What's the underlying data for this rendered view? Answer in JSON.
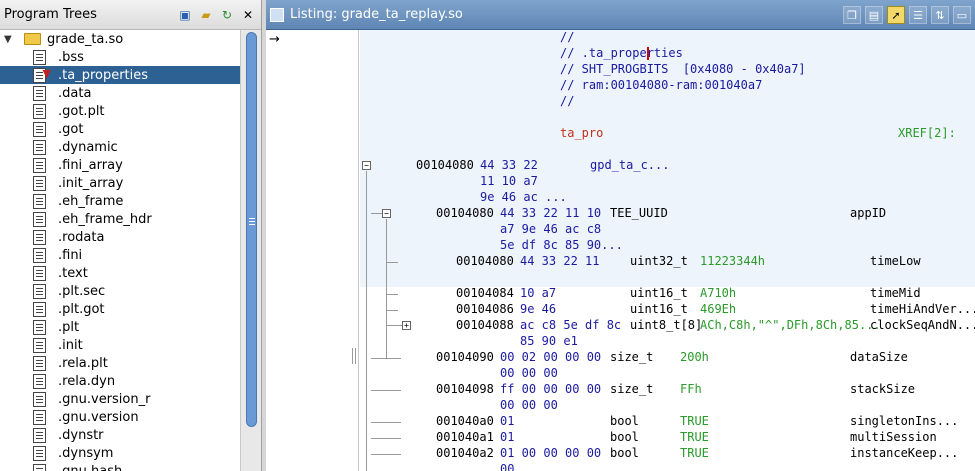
{
  "tree": {
    "title": "Program Trees",
    "root": "grade_ta.so",
    "items": [
      {
        "label": ".bss",
        "selected": false
      },
      {
        "label": ".ta_properties",
        "selected": true
      },
      {
        "label": ".data",
        "selected": false
      },
      {
        "label": ".got.plt",
        "selected": false
      },
      {
        "label": ".got",
        "selected": false
      },
      {
        "label": ".dynamic",
        "selected": false
      },
      {
        "label": ".fini_array",
        "selected": false
      },
      {
        "label": ".init_array",
        "selected": false
      },
      {
        "label": ".eh_frame",
        "selected": false
      },
      {
        "label": ".eh_frame_hdr",
        "selected": false
      },
      {
        "label": ".rodata",
        "selected": false
      },
      {
        "label": ".fini",
        "selected": false
      },
      {
        "label": ".text",
        "selected": false
      },
      {
        "label": ".plt.sec",
        "selected": false
      },
      {
        "label": ".plt.got",
        "selected": false
      },
      {
        "label": ".plt",
        "selected": false
      },
      {
        "label": ".init",
        "selected": false
      },
      {
        "label": ".rela.plt",
        "selected": false
      },
      {
        "label": ".rela.dyn",
        "selected": false
      },
      {
        "label": ".gnu.version_r",
        "selected": false
      },
      {
        "label": ".gnu.version",
        "selected": false
      },
      {
        "label": ".dynstr",
        "selected": false
      },
      {
        "label": ".dynsym",
        "selected": false
      },
      {
        "label": ".gnu.hash",
        "selected": false
      }
    ]
  },
  "listing": {
    "title": "Listing:  grade_ta_replay.so",
    "comments": [
      "//",
      "// .ta_properties",
      "// SHT_PROGBITS  [0x4080 - 0x40a7]",
      "// ram:00104080-ram:001040a7",
      "//"
    ],
    "label": "ta_pro",
    "xref": "XREF[2]:",
    "rows": [
      {
        "addr": "00104080",
        "bytes": "44 33 22",
        "mnem": "gpd_ta_c...",
        "type": "",
        "val": "",
        "name": ""
      },
      {
        "addr": "",
        "bytes": "11 10 a7",
        "mnem": "",
        "type": "",
        "val": "",
        "name": ""
      },
      {
        "addr": "",
        "bytes": "9e 46 ac ...",
        "mnem": "",
        "type": "",
        "val": "",
        "name": ""
      },
      {
        "addr": "00104080",
        "bytes": "44 33 22 11 10",
        "mnem": "",
        "type": "TEE_UUID",
        "val": "",
        "name": "appID"
      },
      {
        "addr": "",
        "bytes": "a7 9e 46 ac c8",
        "mnem": "",
        "type": "",
        "val": "",
        "name": ""
      },
      {
        "addr": "",
        "bytes": "5e df 8c 85 90...",
        "mnem": "",
        "type": "",
        "val": "",
        "name": ""
      },
      {
        "addr": "00104080",
        "bytes": "44 33 22 11",
        "mnem": "",
        "type": "uint32_t",
        "val": "11223344h",
        "name": "timeLow"
      },
      {
        "addr": "00104084",
        "bytes": "10 a7",
        "mnem": "",
        "type": "uint16_t",
        "val": "A710h",
        "name": "timeMid"
      },
      {
        "addr": "00104086",
        "bytes": "9e 46",
        "mnem": "",
        "type": "uint16_t",
        "val": "469Eh",
        "name": "timeHiAndVer..."
      },
      {
        "addr": "00104088",
        "bytes": "ac c8 5e df 8c",
        "mnem": "",
        "type": "uint8_t[8]",
        "val": "ACh,C8h,\"^\",DFh,8Ch,85...",
        "name": "clockSeqAndN..."
      },
      {
        "addr": "",
        "bytes": "85 90 e1",
        "mnem": "",
        "type": "",
        "val": "",
        "name": ""
      },
      {
        "addr": "00104090",
        "bytes": "00 02 00 00 00",
        "mnem": "",
        "type": "size_t",
        "val": "200h",
        "name": "dataSize"
      },
      {
        "addr": "",
        "bytes": "00 00 00",
        "mnem": "",
        "type": "",
        "val": "",
        "name": ""
      },
      {
        "addr": "00104098",
        "bytes": "ff 00 00 00 00",
        "mnem": "",
        "type": "size_t",
        "val": "FFh",
        "name": "stackSize"
      },
      {
        "addr": "",
        "bytes": "00 00 00",
        "mnem": "",
        "type": "",
        "val": "",
        "name": ""
      },
      {
        "addr": "001040a0",
        "bytes": "01",
        "mnem": "",
        "type": "bool",
        "val": "TRUE",
        "name": "singletonIns..."
      },
      {
        "addr": "001040a1",
        "bytes": "01",
        "mnem": "",
        "type": "bool",
        "val": "TRUE",
        "name": "multiSession"
      },
      {
        "addr": "001040a2",
        "bytes": "01 00 00 00 00",
        "mnem": "",
        "type": "bool",
        "val": "TRUE",
        "name": "instanceKeep..."
      },
      {
        "addr": "",
        "bytes": "00",
        "mnem": "",
        "type": "",
        "val": "",
        "name": ""
      }
    ]
  }
}
